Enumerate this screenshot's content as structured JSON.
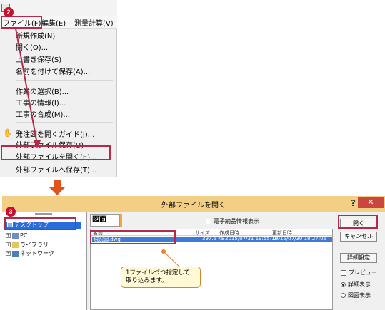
{
  "menu": {
    "badge": "2",
    "bar": {
      "file": "ファイル(F)",
      "edit": "編集(E)",
      "survey": "測量計算(V)"
    },
    "items": [
      "新規作成(N)",
      "開く(O)...",
      "上書き保存(S)",
      "名前を付けて保存(A)...",
      "作業の選択(B)...",
      "工事の情報(I)...",
      "工事の合成(M)...",
      "発注図を開くガイド(J)...",
      "外部ファイル保存(U)",
      "外部ファイルを開く(E)...",
      "外部ファイルへ保存(T)..."
    ]
  },
  "dialog": {
    "badge": "3",
    "title": "外部ファイルを開く",
    "help": "?",
    "close": "✕",
    "tree": {
      "selected": "デスクトップ",
      "items": [
        "PC",
        "ライブラリ",
        "ネットワーク"
      ]
    },
    "tab": "図面",
    "electronic_checkbox": "電子納品情報表示",
    "columns": {
      "name": "名前",
      "size": "サイズ",
      "created": "作成日時",
      "updated": "更新日時"
    },
    "file": {
      "name": "現況図.dwg",
      "size": "397.5 KB",
      "created": "2015/07/31 19:55:19",
      "updated": "2015/07/30 18:27:06"
    },
    "tooltip": [
      "1ファイルづつ指定して",
      "取り込みます。"
    ],
    "buttons": {
      "open": "開く",
      "cancel": "キャンセル",
      "detail": "詳細設定"
    },
    "preview": "プレビュー",
    "view_detail": "詳細表示",
    "view_figure": "図面表示"
  },
  "colors": {
    "highlight": "#b5294a",
    "badge": "#c8102e",
    "arrow": "#e0531f",
    "titlebar": "#f3cf86",
    "selection": "#2b6cdc"
  }
}
